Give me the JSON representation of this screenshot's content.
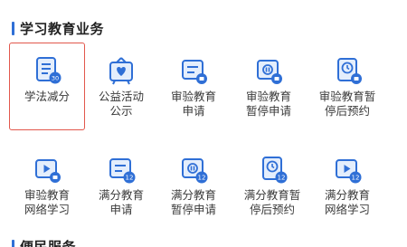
{
  "sections": {
    "study": {
      "title": "学习教育业务"
    },
    "service": {
      "title": "便民服务"
    }
  },
  "tiles": [
    {
      "label": "学法减分",
      "icon": "book-list-icon",
      "badge": "30",
      "selected": true
    },
    {
      "label": "公益活动\n公示",
      "icon": "heart-easel-icon",
      "badge": ""
    },
    {
      "label": "审验教育\n申请",
      "icon": "form-doc-icon",
      "badge": ""
    },
    {
      "label": "审验教育\n暂停申请",
      "icon": "pause-doc-icon",
      "badge": ""
    },
    {
      "label": "审验教育暂\n停后预约",
      "icon": "clock-doc-icon",
      "badge": ""
    },
    {
      "label": "审验教育\n网络学习",
      "icon": "video-play-icon",
      "badge": ""
    },
    {
      "label": "满分教育\n申请",
      "icon": "form-doc-12-icon",
      "badge": "12"
    },
    {
      "label": "满分教育\n暂停申请",
      "icon": "pause-doc-12-icon",
      "badge": "12"
    },
    {
      "label": "满分教育暂\n停后预约",
      "icon": "clock-doc-12-icon",
      "badge": "12"
    },
    {
      "label": "满分教育\n网络学习",
      "icon": "video-play-12-icon",
      "badge": "12"
    }
  ],
  "colors": {
    "accent": "#2f6fd6",
    "icon_bg": "#e4eefc",
    "selected_border": "#e2574c"
  }
}
